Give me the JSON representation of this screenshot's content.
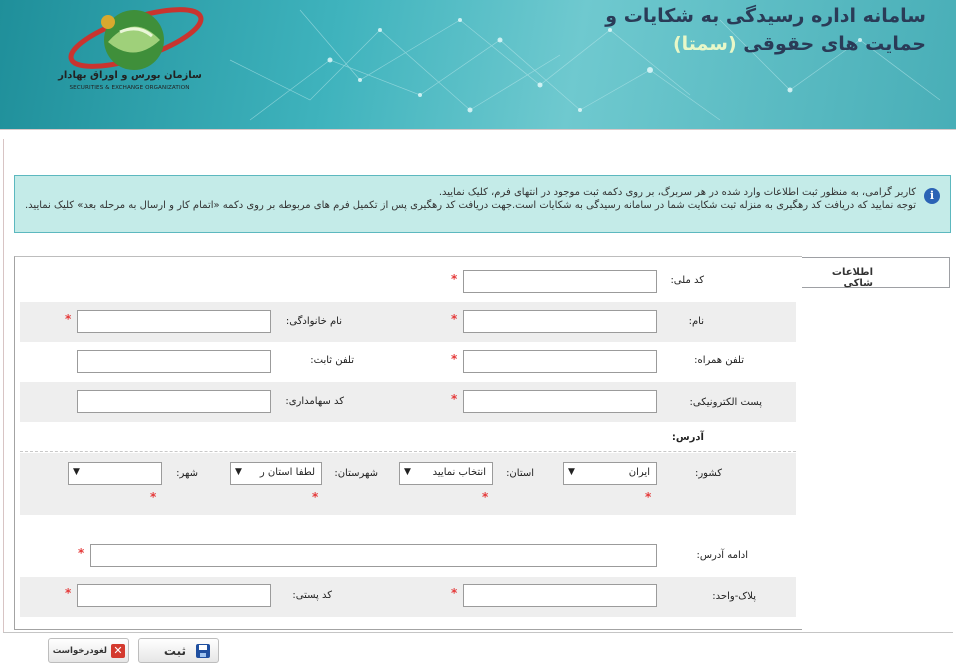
{
  "header": {
    "title_line1": "سامانه اداره رسیدگی به شکایات و",
    "title_line2_prefix": "حمایت های حقوقی ",
    "title_line2_highlight": "(سمتا)",
    "org_name_fa": "سازمان بورس و اوراق بهادار",
    "org_name_en": "SECURITIES & EXCHANGE ORGANIZATION"
  },
  "notice": {
    "icon": "info-icon",
    "line1": "کاربر گرامی، به منظور ثبت اطلاعات وارد شده در هر سربرگ، بر روی دکمه ثبت موجود در انتهای فرم، کلیک نمایید.",
    "line2": "توجه نمایید که دریافت کد رهگیری به منزله ثبت شکایت شما در سامانه رسیدگی به شکایات است.جهت دریافت کد رهگیری پس از تکمیل فرم های مربوطه بر روی دکمه «اتمام کار و ارسال به مرحله بعد» کلیک نمایید."
  },
  "tabs": [
    {
      "label": "اطلاعات شاکی"
    }
  ],
  "form": {
    "required_mark": "*",
    "national_code": {
      "label": "کد ملی:",
      "value": ""
    },
    "first_name": {
      "label": "نام:",
      "value": ""
    },
    "last_name": {
      "label": "نام خانوادگی:",
      "value": ""
    },
    "mobile": {
      "label": "تلفن همراه:",
      "value": ""
    },
    "phone": {
      "label": "تلفن ثابت:",
      "value": ""
    },
    "email": {
      "label": "پست الکترونیکی:",
      "value": ""
    },
    "shareholder_code": {
      "label": "کد سهامداری:",
      "value": ""
    },
    "address_heading": "آدرس:",
    "country": {
      "label": "کشور:",
      "value": "ایران"
    },
    "province": {
      "label": "استان:",
      "value": "انتخاب نمایید"
    },
    "county": {
      "label": "شهرستان:",
      "value": "لطفا استان ر"
    },
    "city": {
      "label": "شهر:",
      "value": ""
    },
    "address_more": {
      "label": "ادامه آدرس:",
      "value": ""
    },
    "plaque": {
      "label": "پلاک-واحد:",
      "value": ""
    },
    "postal_code": {
      "label": "کد پستی:",
      "value": ""
    }
  },
  "buttons": {
    "submit": {
      "label": "ثبت",
      "icon": "save-icon"
    },
    "cancel": {
      "label": "لغودرخواست",
      "icon": "cancel-icon"
    }
  },
  "colors": {
    "header_teal": "#3fb3bd",
    "notice_bg": "#c4ebe8",
    "required": "#e53a3a",
    "title_dark": "#2a3b57"
  }
}
